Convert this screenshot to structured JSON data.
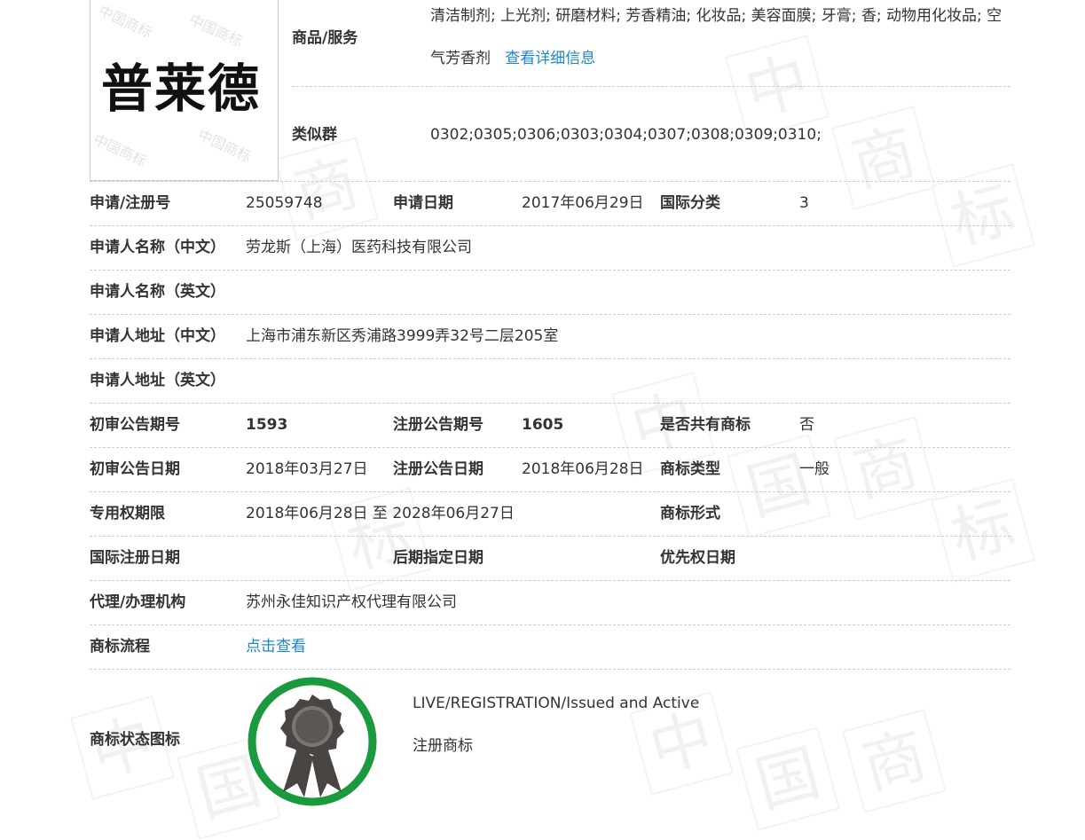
{
  "logo": {
    "text": "普莱德"
  },
  "goods": {
    "label": "商品/服务",
    "line1": "清洁制剂; 上光剂; 研磨材料; 芳香精油; 化妆品; 美容面膜; 牙膏; 香; 动物用化妆品; 空",
    "line2": "气芳香剂",
    "link": "查看详细信息"
  },
  "similar": {
    "label": "类似群",
    "value": "0302;0305;0306;0303;0304;0307;0308;0309;0310;"
  },
  "rows": {
    "reg_no_label": "申请/注册号",
    "reg_no": "25059748",
    "apply_date_label": "申请日期",
    "apply_date": "2017年06月29日",
    "intl_class_label": "国际分类",
    "intl_class": "3",
    "applicant_cn_label": "申请人名称（中文）",
    "applicant_cn": "劳龙斯（上海）医药科技有限公司",
    "applicant_en_label": "申请人名称（英文）",
    "applicant_en": "",
    "address_cn_label": "申请人地址（中文）",
    "address_cn": "上海市浦东新区秀浦路3999弄32号二层205室",
    "address_en_label": "申请人地址（英文）",
    "address_en": "",
    "prelim_no_label": "初审公告期号",
    "prelim_no": "1593",
    "reg_notice_no_label": "注册公告期号",
    "reg_notice_no": "1605",
    "shared_label": "是否共有商标",
    "shared": "否",
    "prelim_date_label": "初审公告日期",
    "prelim_date": "2018年03月27日",
    "reg_notice_date_label": "注册公告日期",
    "reg_notice_date": "2018年06月28日",
    "tm_type_label": "商标类型",
    "tm_type": "一般",
    "exclusive_label": "专用权期限",
    "exclusive": "2018年06月28日 至 2028年06月27日",
    "tm_form_label": "商标形式",
    "tm_form": "",
    "intl_reg_date_label": "国际注册日期",
    "intl_reg_date": "",
    "later_date_label": "后期指定日期",
    "later_date": "",
    "priority_label": "优先权日期",
    "priority": "",
    "agent_label": "代理/办理机构",
    "agent": "苏州永佳知识产权代理有限公司",
    "flow_label": "商标流程",
    "flow_link": "点击查看"
  },
  "status": {
    "label": "商标状态图标",
    "en": "LIVE/REGISTRATION/Issued and Active",
    "cn": "注册商标",
    "icon": "award-badge-icon",
    "ring_color": "#1a9a3e"
  },
  "watermark_char": "中",
  "watermark_chars2": "国",
  "watermark_chars3": "商",
  "watermark_chars4": "标",
  "logo_wm_text": "中国商标"
}
